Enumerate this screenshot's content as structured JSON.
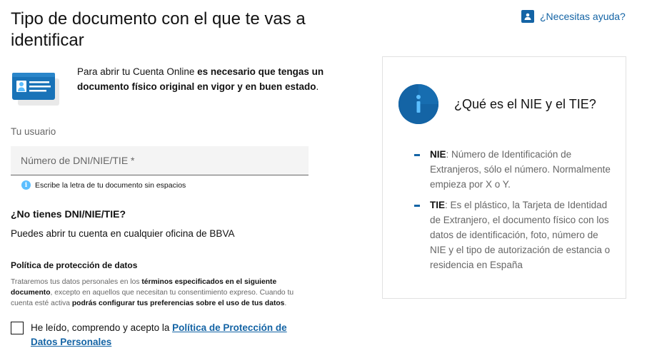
{
  "header": {
    "title": "Tipo de documento con el que te vas a identificar",
    "help_label": "¿Necesitas ayuda?"
  },
  "intro": {
    "text_prefix": "Para abrir tu Cuenta Online ",
    "text_bold": "es necesario que tengas un documento físico original en vigor y en buen estado",
    "text_suffix": "."
  },
  "form": {
    "user_label": "Tu usuario",
    "document_placeholder": "Número de DNI/NIE/TIE *",
    "document_value": "",
    "hint": "Escribe la letra de tu documento sin espacios"
  },
  "no_dni": {
    "title": "¿No tienes DNI/NIE/TIE?",
    "text": "Puedes abrir tu cuenta en cualquier oficina de BBVA"
  },
  "policy": {
    "title": "Política de protección de datos",
    "text_1": "Trataremos tus datos personales en los ",
    "bold_1": "términos especificados en el siguiente documento",
    "text_2": ", excepto en aquellos que necesitan tu consentimiento expreso. Cuando tu cuenta esté activa ",
    "bold_2": "podrás configurar tus preferencias sobre el uso de tus datos",
    "text_3": "."
  },
  "consent": {
    "checked": false,
    "text": "He leído, comprendo y acepto la ",
    "link": "Política de Protección de Datos Personales"
  },
  "info_panel": {
    "heading": "¿Qué es el NIE y el TIE?",
    "items": [
      {
        "term": "NIE",
        "description": ": Número de Identificación de Extranjeros, sólo el número. Normalmente empieza por X o Y."
      },
      {
        "term": "TIE",
        "description": ": Es el plástico, la Tarjeta de Identidad de Extranjero, el documento físico con los datos de identificación, foto, número de NIE y el tipo de autorización de estancia o residencia en España"
      }
    ]
  },
  "colors": {
    "brand_blue": "#1464a5",
    "light_blue": "#5bbeff",
    "text": "#121212",
    "muted": "#666666"
  }
}
